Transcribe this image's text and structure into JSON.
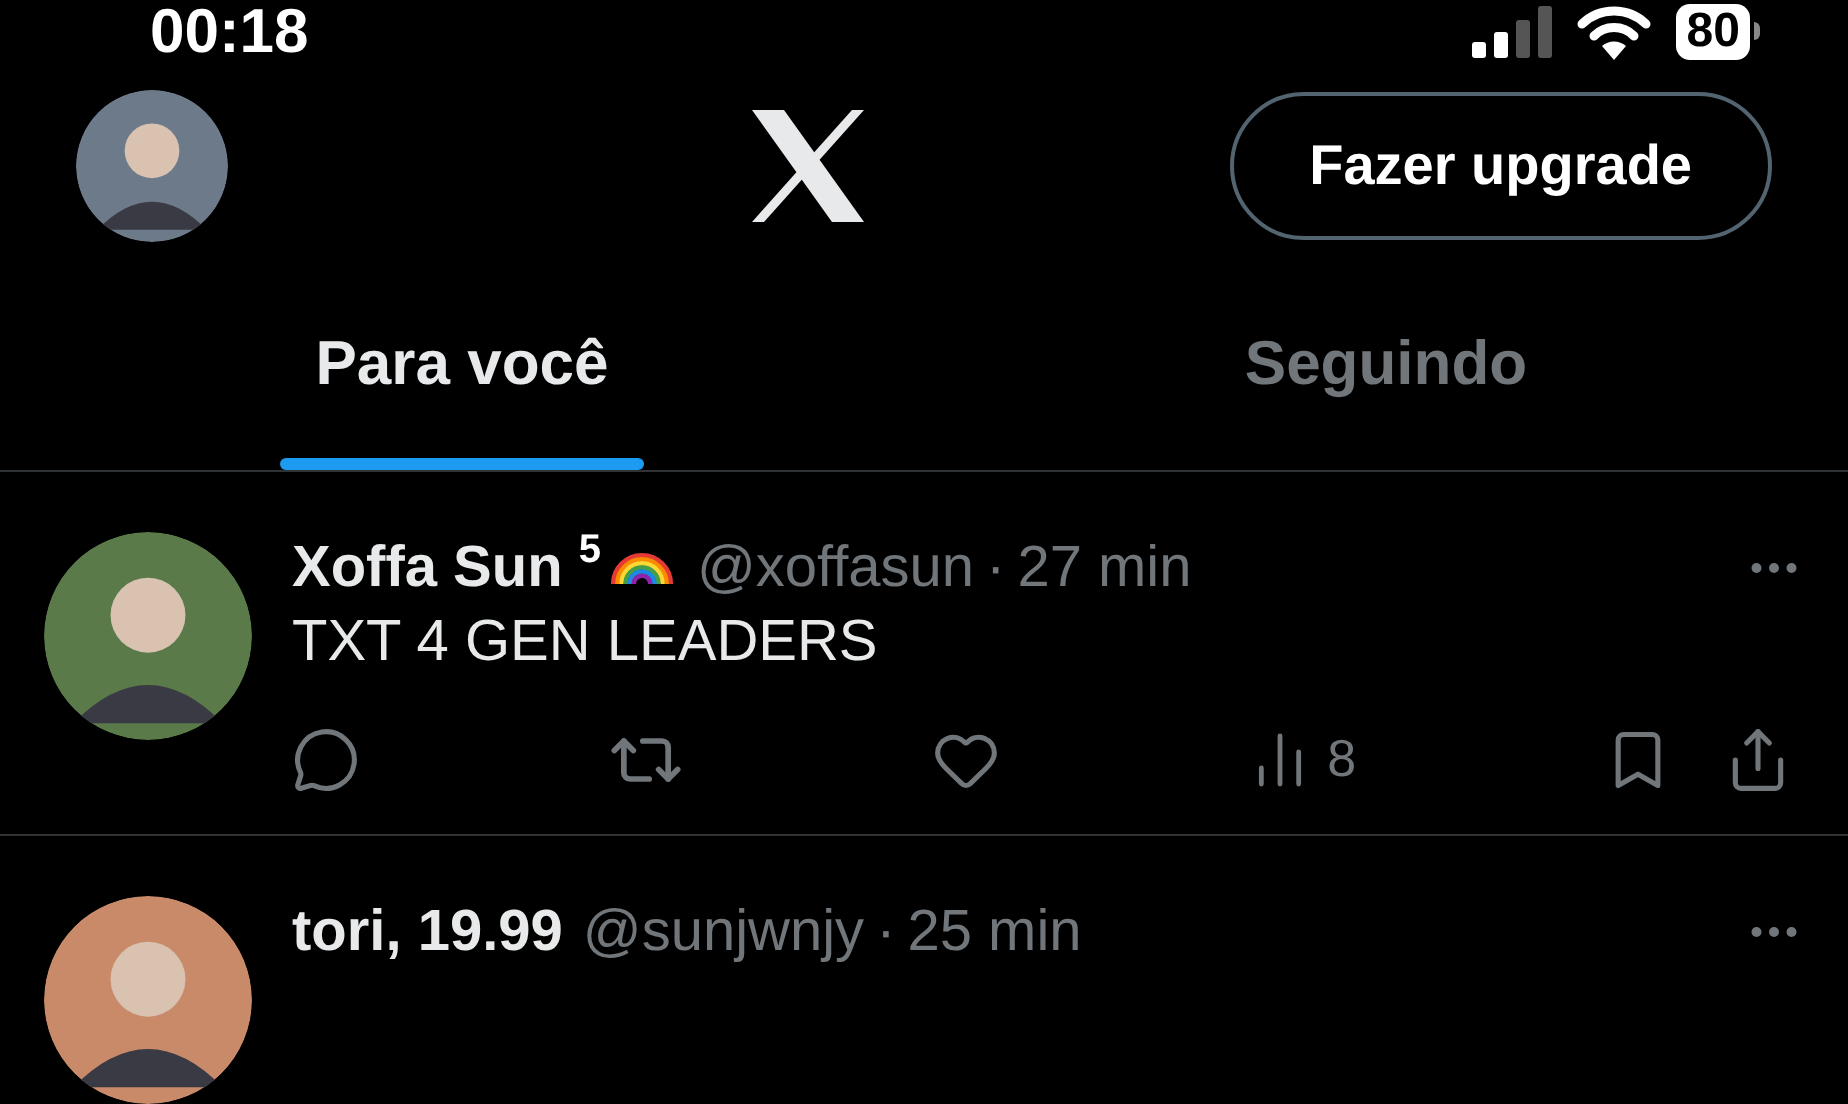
{
  "status_bar": {
    "time": "00:18",
    "battery": "80"
  },
  "header": {
    "upgrade_button": "Fazer upgrade"
  },
  "tabs": [
    {
      "label": "Para você",
      "selected": true
    },
    {
      "label": "Seguindo",
      "selected": false
    }
  ],
  "posts": [
    {
      "name": "Xoffa Sun",
      "badge": "5",
      "flair": true,
      "handle": "@xoffasun",
      "separator": "·",
      "time": "27 min",
      "text": "TXT 4 GEN LEADERS",
      "views": "8"
    },
    {
      "name": "tori, 19.99",
      "flair": false,
      "handle": "@sunjwnjy",
      "separator": "·",
      "time": "25 min"
    }
  ]
}
